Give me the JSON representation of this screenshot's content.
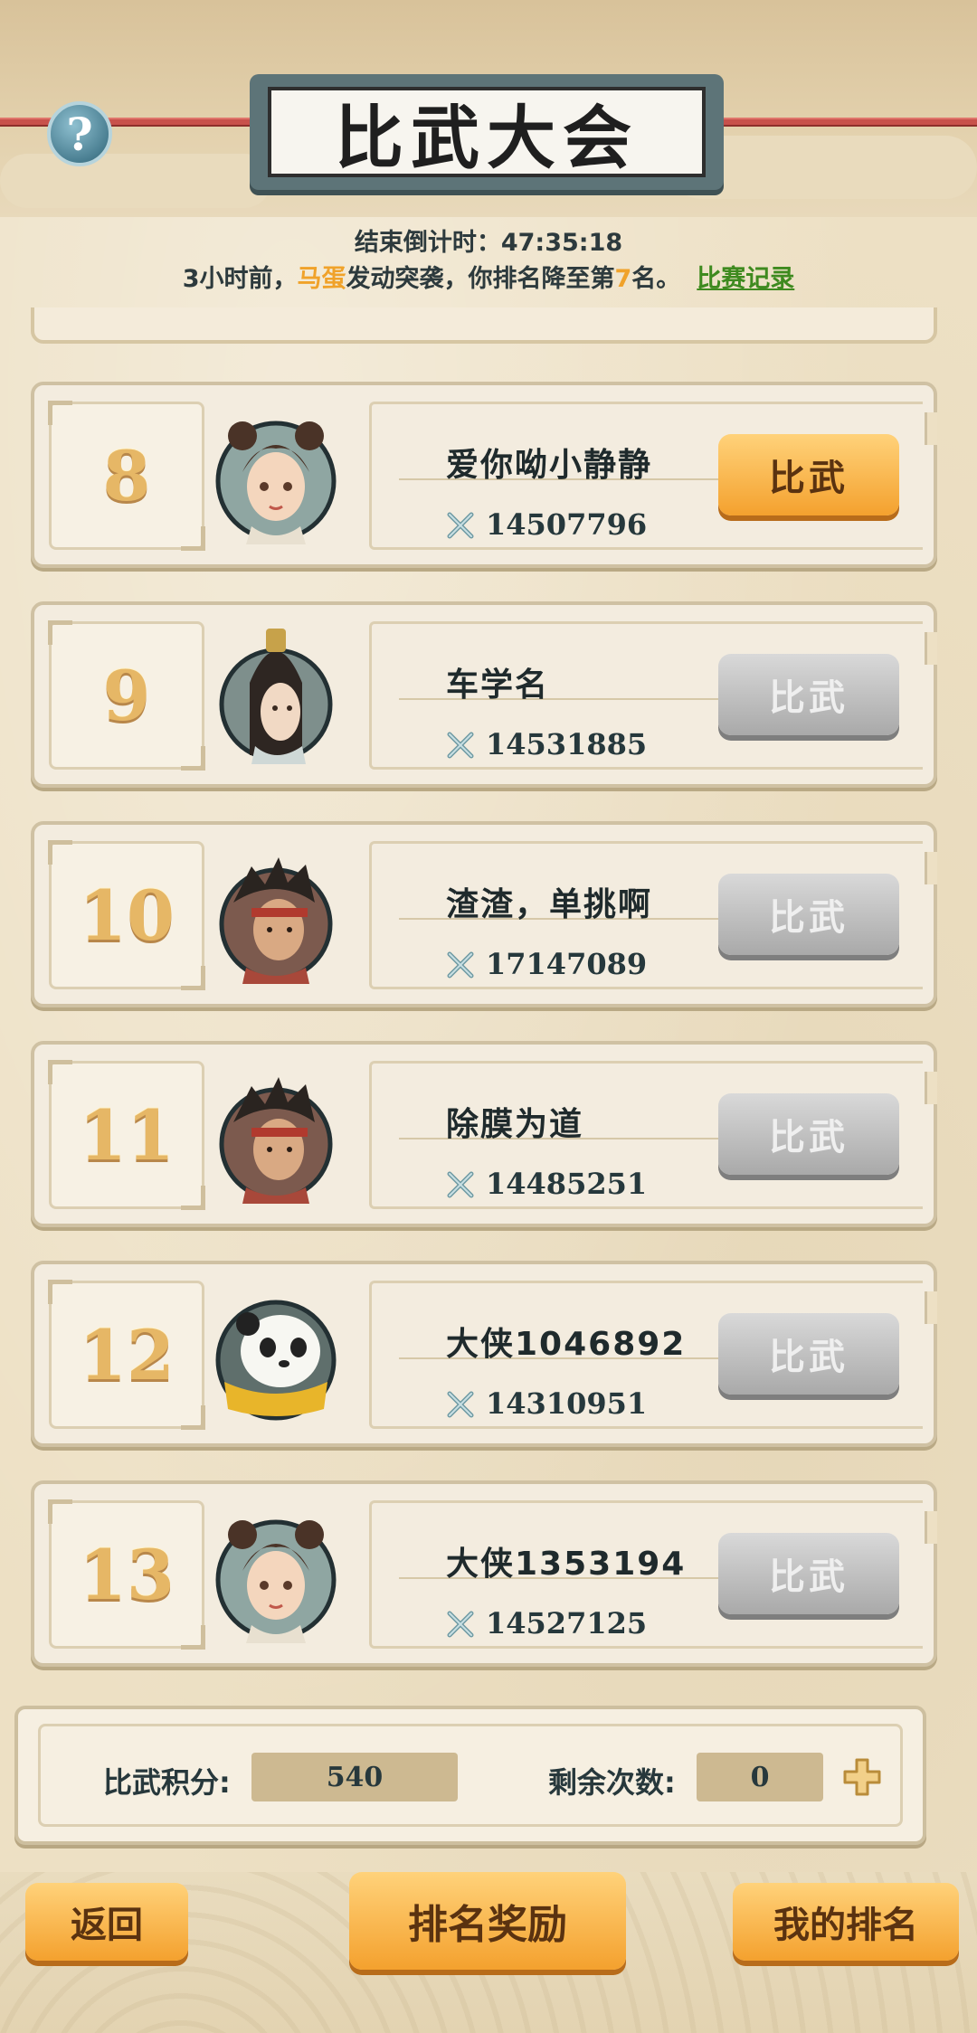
{
  "header": {
    "title": "比武大会",
    "help_symbol": "?"
  },
  "countdown": {
    "label": "结束倒计时：",
    "time": "47:35:18"
  },
  "notice": {
    "prefix": "3小时前，",
    "attacker": "马蛋",
    "middle": "发动突袭，你排名降至第",
    "rank": "7",
    "suffix": "名。",
    "record_link": "比赛记录"
  },
  "opponents": [
    {
      "rank": "8",
      "name": "爱你呦小静静",
      "power": "14507796",
      "button": "比武",
      "state": "active",
      "avatar": "female-hairbuns"
    },
    {
      "rank": "9",
      "name": "车学名",
      "power": "14531885",
      "button": "比武",
      "state": "disabled",
      "avatar": "male-topknot"
    },
    {
      "rank": "10",
      "name": "渣渣，单挑啊",
      "power": "17147089",
      "button": "比武",
      "state": "disabled",
      "avatar": "male-headband"
    },
    {
      "rank": "11",
      "name": "除膜为道",
      "power": "14485251",
      "button": "比武",
      "state": "disabled",
      "avatar": "male-headband"
    },
    {
      "rank": "12",
      "name": "大侠1046892",
      "power": "14310951",
      "button": "比武",
      "state": "disabled",
      "avatar": "panda"
    },
    {
      "rank": "13",
      "name": "大侠1353194",
      "power": "14527125",
      "button": "比武",
      "state": "disabled",
      "avatar": "female-hairbuns"
    }
  ],
  "stats": {
    "points_label": "比武积分:",
    "points_value": "540",
    "remaining_label": "剩余次数:",
    "remaining_value": "0"
  },
  "bottom_buttons": {
    "back": "返回",
    "rank_rewards": "排名奖励",
    "my_rank": "我的排名"
  },
  "colors": {
    "accent_orange": "#f4a12e",
    "disabled_gray": "#a9a9a9",
    "link_green": "#3e8a1f",
    "highlight_yellow": "#f0a22a"
  }
}
